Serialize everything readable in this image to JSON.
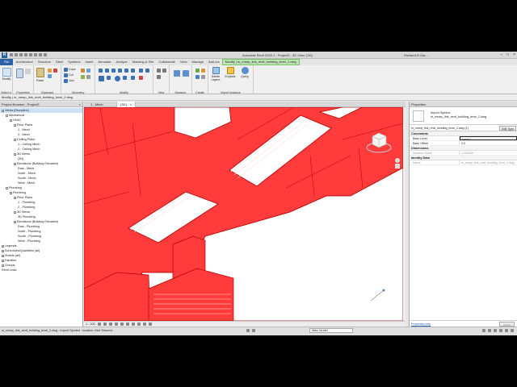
{
  "titlebar": {
    "app_logo": "R",
    "title": "Autodesk Revit 2020.1 - Project3 - 3D View: {3D}",
    "user": "RichardLR.Gar...",
    "win_controls": [
      "–",
      "□",
      "×"
    ]
  },
  "menu": {
    "tabs": [
      "File",
      "Architecture",
      "Structure",
      "Steel",
      "Systems",
      "Insert",
      "Annotate",
      "Analyze",
      "Massing & Site",
      "Collaborate",
      "View",
      "Manage",
      "Add-Ins",
      "Modify | m_mnep_link_revit_building_level_2.dwg"
    ]
  },
  "ribbon": {
    "select_label": "Select ▾",
    "modify_label": "Modify",
    "properties_label": "Properties",
    "clipboard_label": "Clipboard",
    "geometry_label": "Geometry",
    "modify_panel_label": "Modify",
    "view_label": "View",
    "measure_label": "Measure",
    "create_label": "Create",
    "import_instance_label": "Import Instance",
    "paste_label": "Paste",
    "cope_label": "Cope",
    "cut_label": "Cut",
    "join_label": "Join",
    "delete_layers_label": "Delete Layers",
    "explode_label": "Explode",
    "query_label": "Query"
  },
  "options_bar": {
    "text": "Modify | m_mnep_link_revit_building_level_2.dwg"
  },
  "project_browser": {
    "title": "Project Browser - Project3",
    "close": "×",
    "tree": [
      {
        "label": "Views (Discipline)",
        "indent": 0,
        "toggle": "−",
        "selected": true
      },
      {
        "label": "Mechanical",
        "indent": 1,
        "toggle": "−"
      },
      {
        "label": "HVAC",
        "indent": 2,
        "toggle": "−"
      },
      {
        "label": "Floor Plans",
        "indent": 3,
        "toggle": "−"
      },
      {
        "label": "1 - Mech",
        "indent": 4,
        "toggle": ""
      },
      {
        "label": "2 - Mech",
        "indent": 4,
        "toggle": ""
      },
      {
        "label": "Ceiling Plans",
        "indent": 3,
        "toggle": "−"
      },
      {
        "label": "1 - Ceiling Mech",
        "indent": 4,
        "toggle": ""
      },
      {
        "label": "2 - Ceiling Mech",
        "indent": 4,
        "toggle": ""
      },
      {
        "label": "3D Views",
        "indent": 3,
        "toggle": "−"
      },
      {
        "label": "{3D}",
        "indent": 4,
        "toggle": ""
      },
      {
        "label": "Elevations (Building Elevation)",
        "indent": 3,
        "toggle": "−"
      },
      {
        "label": "East - Mech",
        "indent": 4,
        "toggle": ""
      },
      {
        "label": "North - Mech",
        "indent": 4,
        "toggle": ""
      },
      {
        "label": "South - Mech",
        "indent": 4,
        "toggle": ""
      },
      {
        "label": "West - Mech",
        "indent": 4,
        "toggle": ""
      },
      {
        "label": "Plumbing",
        "indent": 1,
        "toggle": "−"
      },
      {
        "label": "Plumbing",
        "indent": 2,
        "toggle": "−"
      },
      {
        "label": "Floor Plans",
        "indent": 3,
        "toggle": "−"
      },
      {
        "label": "1 - Plumbing",
        "indent": 4,
        "toggle": ""
      },
      {
        "label": "2 - Plumbing",
        "indent": 4,
        "toggle": ""
      },
      {
        "label": "3D Views",
        "indent": 3,
        "toggle": "−"
      },
      {
        "label": "3D Plumbing",
        "indent": 4,
        "toggle": ""
      },
      {
        "label": "Elevations (Building Elevation)",
        "indent": 3,
        "toggle": "−"
      },
      {
        "label": "East - Plumbing",
        "indent": 4,
        "toggle": ""
      },
      {
        "label": "North - Plumbing",
        "indent": 4,
        "toggle": ""
      },
      {
        "label": "South - Plumbing",
        "indent": 4,
        "toggle": ""
      },
      {
        "label": "West - Plumbing",
        "indent": 4,
        "toggle": ""
      },
      {
        "label": "Legends",
        "indent": 0,
        "toggle": "+"
      },
      {
        "label": "Schedules/Quantities (all)",
        "indent": 0,
        "toggle": "+"
      },
      {
        "label": "Sheets (all)",
        "indent": 0,
        "toggle": "+"
      },
      {
        "label": "Families",
        "indent": 0,
        "toggle": "+"
      },
      {
        "label": "Groups",
        "indent": 0,
        "toggle": "+"
      },
      {
        "label": "Revit Links",
        "indent": 0,
        "toggle": ""
      }
    ]
  },
  "view_tabs": [
    {
      "label": "1 - Mech",
      "active": false
    },
    {
      "label": "{3D}",
      "active": true
    }
  ],
  "view_close": "×",
  "view_controls": {
    "scale": "1 : 100"
  },
  "properties": {
    "title": "Properties",
    "type_line1": "Import Symbol",
    "type_line2": "m_mnep_link_revit_building_level_2.dwg",
    "instance_selector": "m_mnep_link_revit_building_level_2.dwg (1)",
    "edit_type": "Edit Type",
    "groups": [
      {
        "name": "Constraints",
        "rows": [
          {
            "key": "Base Level",
            "value": "Level 1",
            "boxed": true,
            "dim": false
          },
          {
            "key": "Base Offset",
            "value": "0.0",
            "boxed": false,
            "dim": false
          }
        ]
      },
      {
        "name": "Dimensions",
        "rows": [
          {
            "key": "Instance Scale",
            "value": "1.000000",
            "boxed": false,
            "dim": true
          }
        ]
      },
      {
        "name": "Identity Data",
        "rows": [
          {
            "key": "Name",
            "value": "m_mnep_link_revit_building_level_2.dwg",
            "boxed": false,
            "dim": true
          }
        ]
      }
    ],
    "help_link": "Properties help",
    "apply": "Apply"
  },
  "status": {
    "text": "m_mnep_link_revit_building_level_2.dwg : Import Symbol : location <Not Shared>",
    "main_model": "Main Model"
  },
  "colors": {
    "import_fill": "#ff3b3b",
    "import_line": "#b30000",
    "file_tab": "#2a62a8",
    "context_tab": "#bfe6b5"
  }
}
